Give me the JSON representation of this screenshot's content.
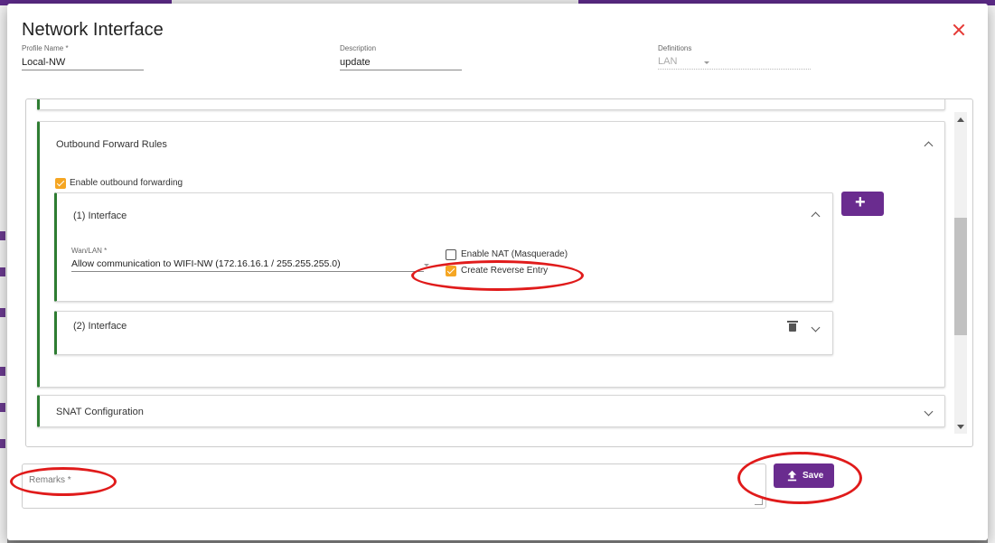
{
  "dialog": {
    "title": "Network Interface"
  },
  "fields": {
    "profile_name": {
      "label": "Profile Name *",
      "value": "Local-NW"
    },
    "description": {
      "label": "Description",
      "value": "update"
    },
    "definitions": {
      "label": "Definitions",
      "value": "LAN"
    }
  },
  "outbound": {
    "title": "Outbound Forward Rules",
    "enable_label": "Enable outbound forwarding",
    "enable_checked": true,
    "interfaces": [
      {
        "title": "(1) Interface",
        "wan_label": "Wan/LAN *",
        "wan_value": "Allow communication to WIFI-NW (172.16.16.1 / 255.255.255.0)",
        "nat_label": "Enable NAT (Masquerade)",
        "nat_checked": false,
        "reverse_label": "Create Reverse Entry",
        "reverse_checked": true
      },
      {
        "title": "(2) Interface"
      }
    ]
  },
  "snat": {
    "title": "SNAT Configuration"
  },
  "remarks": {
    "placeholder": "Remarks *"
  },
  "save": {
    "label": "Save"
  },
  "colors": {
    "accent": "#6a2c8f",
    "section_bar": "#2e7d32",
    "checkbox": "#f5a623",
    "close": "#e53935",
    "annotation": "#e01b1b"
  },
  "icons": [
    "close-icon",
    "chevron-up-icon",
    "chevron-down-icon",
    "plus-icon",
    "trash-icon",
    "upload-icon",
    "dropdown-caret-icon"
  ]
}
